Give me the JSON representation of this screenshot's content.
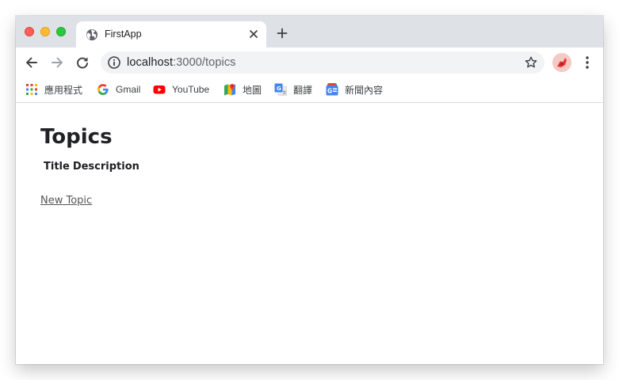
{
  "browser": {
    "tab": {
      "title": "FirstApp"
    },
    "address_bar": {
      "host": "localhost",
      "path": ":3000/topics"
    },
    "bookmarks": [
      {
        "label": "應用程式",
        "icon": "apps-grid-icon"
      },
      {
        "label": "Gmail",
        "icon": "google-icon"
      },
      {
        "label": "YouTube",
        "icon": "youtube-icon"
      },
      {
        "label": "地圖",
        "icon": "maps-icon"
      },
      {
        "label": "翻譯",
        "icon": "translate-icon"
      },
      {
        "label": "新聞內容",
        "icon": "news-icon"
      }
    ]
  },
  "page": {
    "heading": "Topics",
    "table_headers": [
      "Title",
      "Description"
    ],
    "new_topic_link": "New Topic"
  }
}
